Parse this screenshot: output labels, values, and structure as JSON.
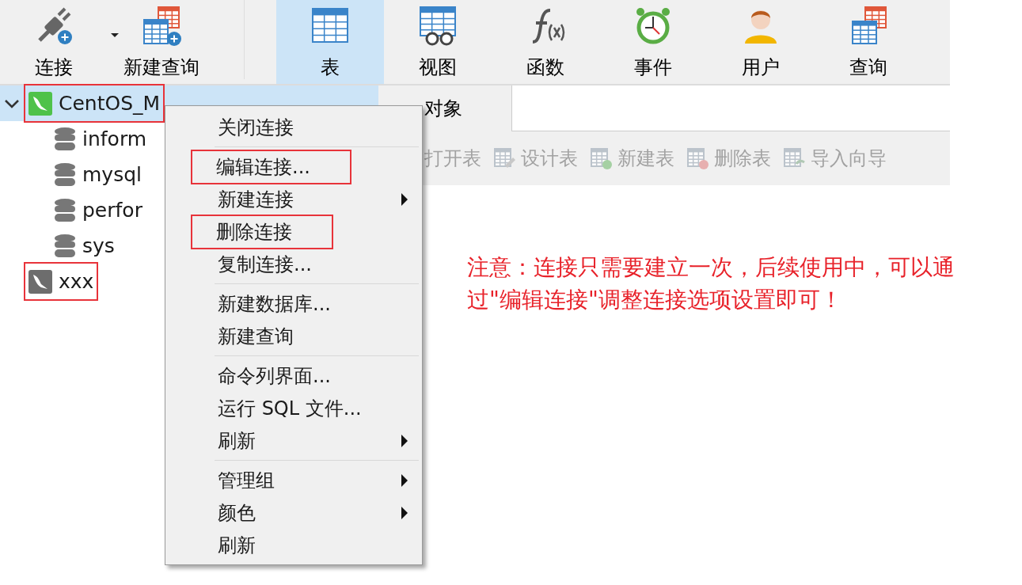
{
  "toolbar": [
    {
      "kind": "connect",
      "label": "连接",
      "selected": false,
      "dropdown": true
    },
    {
      "kind": "new-query",
      "label": "新建查询",
      "selected": false,
      "dropdown": false
    },
    {
      "kind": "table",
      "label": "表",
      "selected": true,
      "dropdown": false
    },
    {
      "kind": "view",
      "label": "视图",
      "selected": false,
      "dropdown": false
    },
    {
      "kind": "function",
      "label": "函数",
      "selected": false,
      "dropdown": false
    },
    {
      "kind": "event",
      "label": "事件",
      "selected": false,
      "dropdown": false
    },
    {
      "kind": "user",
      "label": "用户",
      "selected": false,
      "dropdown": false
    },
    {
      "kind": "query",
      "label": "查询",
      "selected": false,
      "dropdown": false
    }
  ],
  "tree": [
    {
      "kind": "connection",
      "label": "CentOS_M",
      "connected": true,
      "selected": true,
      "expanded": true,
      "highlighted": true,
      "children": [
        {
          "kind": "database",
          "label": "inform"
        },
        {
          "kind": "database",
          "label": "mysql"
        },
        {
          "kind": "database",
          "label": "perfor"
        },
        {
          "kind": "database",
          "label": "sys"
        }
      ]
    },
    {
      "kind": "connection",
      "label": "xxx",
      "connected": false,
      "selected": false,
      "expanded": false,
      "highlighted": true
    }
  ],
  "object_tabs": [
    {
      "label": "对象",
      "selected": true
    }
  ],
  "object_toolbar": [
    {
      "kind": "open",
      "label": "打开表",
      "disabled": true
    },
    {
      "kind": "design",
      "label": "设计表",
      "disabled": true
    },
    {
      "kind": "new",
      "label": "新建表",
      "disabled": true
    },
    {
      "kind": "delete",
      "label": "删除表",
      "disabled": true
    },
    {
      "kind": "import",
      "label": "导入向导",
      "disabled": true
    }
  ],
  "context_menu": {
    "items": [
      {
        "kind": "item",
        "label": "关闭连接",
        "submenu": false,
        "highlighted": false
      },
      {
        "kind": "separator"
      },
      {
        "kind": "item",
        "label": "编辑连接...",
        "submenu": false,
        "highlighted": true
      },
      {
        "kind": "item",
        "label": "新建连接",
        "submenu": true,
        "highlighted": false
      },
      {
        "kind": "item",
        "label": "删除连接",
        "submenu": false,
        "highlighted": true
      },
      {
        "kind": "item",
        "label": "复制连接...",
        "submenu": false,
        "highlighted": false
      },
      {
        "kind": "separator"
      },
      {
        "kind": "item",
        "label": "新建数据库...",
        "submenu": false,
        "highlighted": false
      },
      {
        "kind": "item",
        "label": "新建查询",
        "submenu": false,
        "highlighted": false
      },
      {
        "kind": "separator"
      },
      {
        "kind": "item",
        "label": "命令列界面...",
        "submenu": false,
        "highlighted": false
      },
      {
        "kind": "item",
        "label": "运行 SQL 文件...",
        "submenu": false,
        "highlighted": false
      },
      {
        "kind": "item",
        "label": "刷新",
        "submenu": true,
        "highlighted": false
      },
      {
        "kind": "separator"
      },
      {
        "kind": "item",
        "label": "管理组",
        "submenu": true,
        "highlighted": false
      },
      {
        "kind": "item",
        "label": "颜色",
        "submenu": true,
        "highlighted": false
      },
      {
        "kind": "item",
        "label": "刷新",
        "submenu": false,
        "highlighted": false
      }
    ]
  },
  "note": "注意：连接只需要建立一次，后续使用中，可以通过\"编辑连接\"调整连接选项设置即可！"
}
